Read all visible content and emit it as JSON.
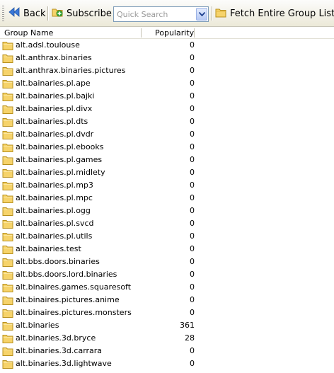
{
  "toolbar": {
    "back_label": "Back",
    "subscribe_label": "Subscribe",
    "search_placeholder": "Quick Search",
    "fetch_label": "Fetch Entire Group List"
  },
  "columns": {
    "name": "Group Name",
    "popularity": "Popularity"
  },
  "colors": {
    "back_arrow": "#2f6fd0",
    "folder_fill": "#f6d36a",
    "folder_edge": "#b8901e"
  },
  "groups": [
    {
      "name": "alt.adsl.toulouse",
      "popularity": "0"
    },
    {
      "name": "alt.anthrax.binaries",
      "popularity": "0"
    },
    {
      "name": "alt.anthrax.binaries.pictures",
      "popularity": "0"
    },
    {
      "name": "alt.bainaries.pl.ape",
      "popularity": "0"
    },
    {
      "name": "alt.bainaries.pl.bajki",
      "popularity": "0"
    },
    {
      "name": "alt.bainaries.pl.divx",
      "popularity": "0"
    },
    {
      "name": "alt.bainaries.pl.dts",
      "popularity": "0"
    },
    {
      "name": "alt.bainaries.pl.dvdr",
      "popularity": "0"
    },
    {
      "name": "alt.bainaries.pl.ebooks",
      "popularity": "0"
    },
    {
      "name": "alt.bainaries.pl.games",
      "popularity": "0"
    },
    {
      "name": "alt.bainaries.pl.midlety",
      "popularity": "0"
    },
    {
      "name": "alt.bainaries.pl.mp3",
      "popularity": "0"
    },
    {
      "name": "alt.bainaries.pl.mpc",
      "popularity": "0"
    },
    {
      "name": "alt.bainaries.pl.ogg",
      "popularity": "0"
    },
    {
      "name": "alt.bainaries.pl.svcd",
      "popularity": "0"
    },
    {
      "name": "alt.bainaries.pl.utils",
      "popularity": "0"
    },
    {
      "name": "alt.bainaries.test",
      "popularity": "0"
    },
    {
      "name": "alt.bbs.doors.binaries",
      "popularity": "0"
    },
    {
      "name": "alt.bbs.doors.lord.binaries",
      "popularity": "0"
    },
    {
      "name": "alt.binaires.games.squaresoft",
      "popularity": "0"
    },
    {
      "name": "alt.binaires.pictures.anime",
      "popularity": "0"
    },
    {
      "name": "alt.binaires.pictures.monsters",
      "popularity": "0"
    },
    {
      "name": "alt.binaries",
      "popularity": "361"
    },
    {
      "name": "alt.binaries.3d.bryce",
      "popularity": "28"
    },
    {
      "name": "alt.binaries.3d.carrara",
      "popularity": "0"
    },
    {
      "name": "alt.binaries.3d.lightwave",
      "popularity": "0"
    },
    {
      "name": "",
      "popularity": ""
    }
  ]
}
